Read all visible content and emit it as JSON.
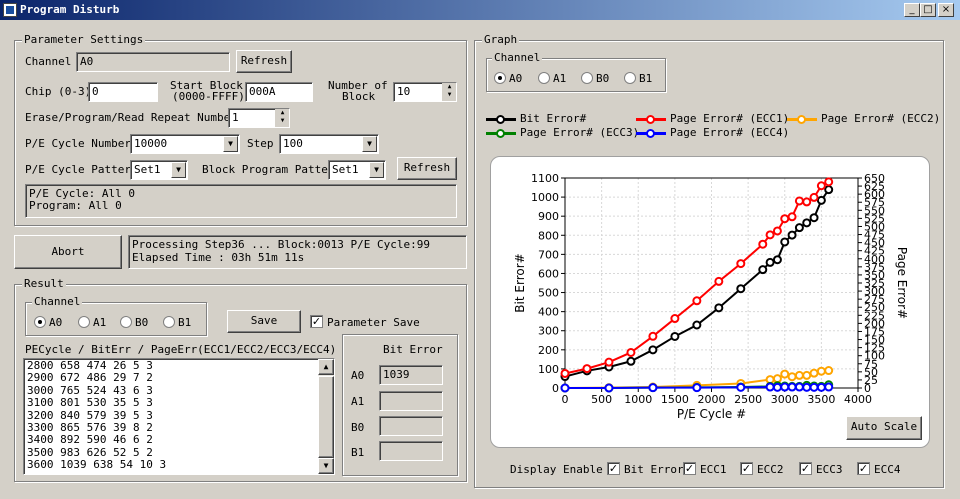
{
  "window": {
    "title": "Program Disturb",
    "min": "_",
    "max": "□",
    "close": "×"
  },
  "params": {
    "group_title": "Parameter Settings",
    "channel_label": "Channel",
    "channel_value": "A0",
    "refresh": "Refresh",
    "chip_label": "Chip (0-3)",
    "chip_value": "0",
    "start_block_label1": "Start Block",
    "start_block_label2": "(0000-FFFF)",
    "start_block_value": "000A",
    "num_block_label1": "Number of",
    "num_block_label2": "Block",
    "num_block_value": "10",
    "repeat_label": "Erase/Program/Read Repeat Number",
    "repeat_value": "1",
    "pe_cycle_label": "P/E Cycle Number",
    "pe_cycle_value": "10000",
    "step_label": "Step",
    "step_value": "100",
    "pattern_label": "P/E Cycle Pattern",
    "pattern_value": "Set1",
    "block_pattern_label": "Block Program Pattern",
    "block_pattern_value": "Set1",
    "refresh2": "Refresh",
    "summary_line1": "P/E Cycle: All 0",
    "summary_line2": "Program: All 0"
  },
  "status": {
    "abort": "Abort",
    "line1": "Processing Step36 ... Block:0013 P/E Cycle:99",
    "line2": "Elapsed Time : 03h 51m 11s"
  },
  "result": {
    "group_title": "Result",
    "channel_group": "Channel",
    "channels": [
      "A0",
      "A1",
      "B0",
      "B1"
    ],
    "selected_channel": "A0",
    "save": "Save",
    "param_save_label": "Parameter Save",
    "param_save_check": "✓",
    "list_header": "PECycle / BitErr / PageErr(ECC1/ECC2/ECC3/ECC4)",
    "rows": [
      "2800 658 474 26 5 3",
      "2900 672 486 29 7 2",
      "3000 765 524 43 6 3",
      "3100 801 530 35 5 3",
      "3200 840 579 39 5 3",
      "3300 865 576 39 8 2",
      "3400 892 590 46 6 2",
      "3500 983 626 52 5 2",
      "3600 1039 638 54 10 3"
    ],
    "scroll_up": "▲",
    "scroll_down": "▼",
    "bit_error_title": "Bit Error",
    "bit_error": [
      {
        "label": "A0",
        "value": "1039"
      },
      {
        "label": "A1",
        "value": ""
      },
      {
        "label": "B0",
        "value": ""
      },
      {
        "label": "B1",
        "value": ""
      }
    ]
  },
  "graph": {
    "group_title": "Graph",
    "channel_group": "Channel",
    "channels": [
      "A0",
      "A1",
      "B0",
      "B1"
    ],
    "selected_channel": "A0",
    "auto_scale": "Auto Scale",
    "display_enable": "Display Enable",
    "enables": [
      {
        "label": "Bit Error",
        "check": "✓"
      },
      {
        "label": "ECC1",
        "check": "✓"
      },
      {
        "label": "ECC2",
        "check": "✓"
      },
      {
        "label": "ECC3",
        "check": "✓"
      },
      {
        "label": "ECC4",
        "check": "✓"
      }
    ]
  },
  "chart_data": {
    "type": "line",
    "xlabel": "P/E Cycle #",
    "ylabel": "Bit Error#",
    "y2label": "Page Error#",
    "xlim": [
      0,
      4000
    ],
    "ylim": [
      0,
      1100
    ],
    "y2lim": [
      0,
      650
    ],
    "xticks": [
      "0",
      "500",
      "1000",
      "1500",
      "2000",
      "2500",
      "3000",
      "3500",
      "4000"
    ],
    "yticks": [
      "0",
      "100",
      "200",
      "300",
      "400",
      "500",
      "600",
      "700",
      "800",
      "900",
      "1000",
      "1100"
    ],
    "y2ticks": [
      "0",
      "25",
      "50",
      "75",
      "100",
      "125",
      "150",
      "175",
      "200",
      "225",
      "250",
      "275",
      "300",
      "325",
      "350",
      "375",
      "400",
      "425",
      "450",
      "475",
      "500",
      "525",
      "550",
      "575",
      "600",
      "625",
      "650"
    ],
    "grid": true,
    "series": [
      {
        "name": "Bit Error#",
        "axis": "left",
        "color": "#000000",
        "x": [
          0,
          300,
          600,
          900,
          1200,
          1500,
          1800,
          2100,
          2400,
          2700,
          2800,
          2900,
          3000,
          3100,
          3200,
          3300,
          3400,
          3500,
          3600
        ],
        "y": [
          60,
          90,
          110,
          140,
          200,
          270,
          330,
          420,
          520,
          620,
          658,
          672,
          765,
          801,
          840,
          865,
          892,
          983,
          1039
        ]
      },
      {
        "name": "Page Error# (ECC1)",
        "axis": "right",
        "color": "#ff0000",
        "x": [
          0,
          300,
          600,
          900,
          1200,
          1500,
          1800,
          2100,
          2400,
          2700,
          2800,
          2900,
          3000,
          3100,
          3200,
          3300,
          3400,
          3500,
          3600
        ],
        "y": [
          45,
          60,
          80,
          110,
          160,
          215,
          270,
          330,
          385,
          445,
          474,
          486,
          524,
          530,
          579,
          576,
          590,
          626,
          638
        ]
      },
      {
        "name": "Page Error# (ECC2)",
        "axis": "right",
        "color": "#ffa500",
        "x": [
          0,
          600,
          1200,
          1800,
          2400,
          2800,
          2900,
          3000,
          3100,
          3200,
          3300,
          3400,
          3500,
          3600
        ],
        "y": [
          0,
          1,
          3,
          8,
          14,
          26,
          29,
          43,
          35,
          39,
          39,
          46,
          52,
          54
        ]
      },
      {
        "name": "Page Error# (ECC3)",
        "axis": "right",
        "color": "#008000",
        "x": [
          0,
          600,
          1200,
          1800,
          2400,
          2800,
          2900,
          3000,
          3100,
          3200,
          3300,
          3400,
          3500,
          3600
        ],
        "y": [
          0,
          0,
          1,
          2,
          3,
          5,
          7,
          6,
          5,
          5,
          8,
          6,
          5,
          10
        ]
      },
      {
        "name": "Page Error# (ECC4)",
        "axis": "right",
        "color": "#0000ff",
        "x": [
          0,
          600,
          1200,
          1800,
          2400,
          2800,
          2900,
          3000,
          3100,
          3200,
          3300,
          3400,
          3500,
          3600
        ],
        "y": [
          0,
          0,
          1,
          1,
          2,
          3,
          2,
          3,
          3,
          3,
          2,
          2,
          2,
          3
        ]
      }
    ]
  }
}
